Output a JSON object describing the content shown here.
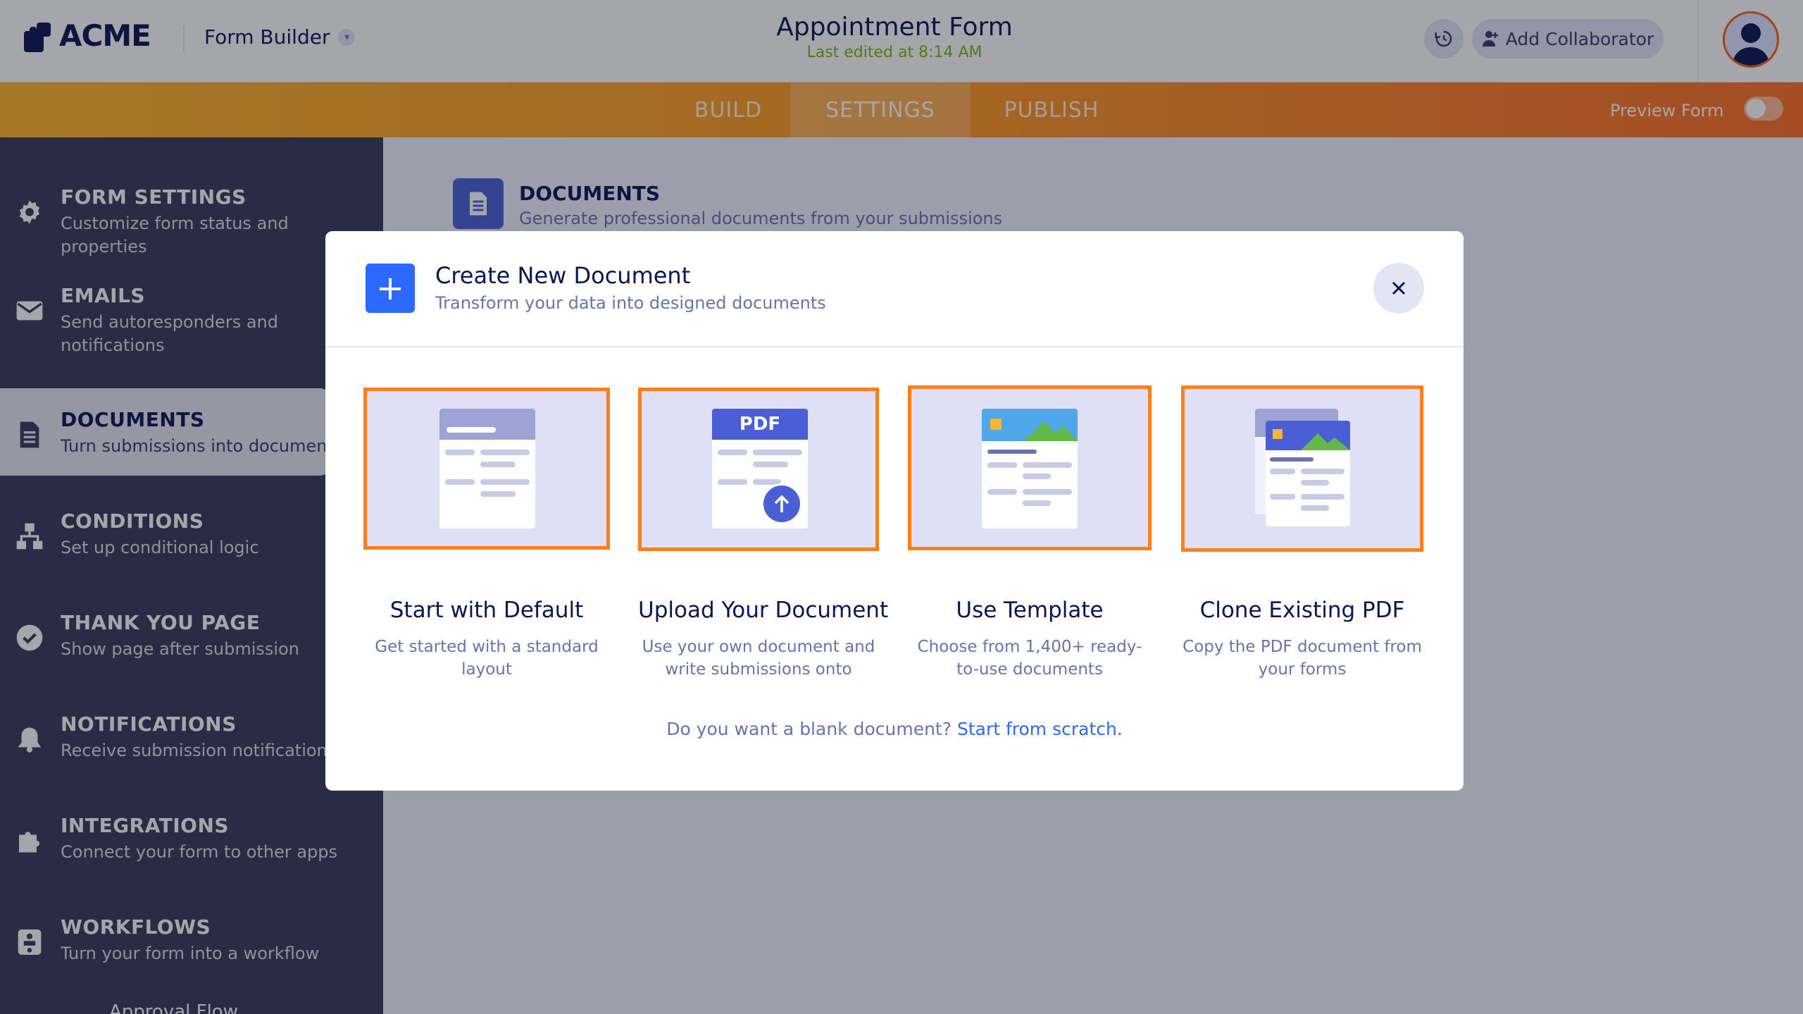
{
  "header": {
    "logo_text": "ACME",
    "builder_label": "Form Builder",
    "form_title": "Appointment Form",
    "last_edited": "Last edited at 8:14 AM",
    "collaborator_label": "Add Collaborator"
  },
  "tabs": [
    {
      "label": "BUILD"
    },
    {
      "label": "SETTINGS"
    },
    {
      "label": "PUBLISH"
    }
  ],
  "preview": {
    "label": "Preview Form",
    "enabled": false
  },
  "sidebar": {
    "items": [
      {
        "title": "FORM SETTINGS",
        "desc": "Customize form status and properties",
        "icon": "gear-icon"
      },
      {
        "title": "EMAILS",
        "desc": "Send autoresponders and notifications",
        "icon": "envelope-icon"
      },
      {
        "title": "DOCUMENTS",
        "desc": "Turn submissions into documents",
        "icon": "document-icon"
      },
      {
        "title": "CONDITIONS",
        "desc": "Set up conditional logic",
        "icon": "flowchart-icon"
      },
      {
        "title": "THANK YOU PAGE",
        "desc": "Show page after submission",
        "icon": "check-circle-icon"
      },
      {
        "title": "NOTIFICATIONS",
        "desc": "Receive submission notifications",
        "icon": "bell-icon"
      },
      {
        "title": "INTEGRATIONS",
        "desc": "Connect your form to other apps",
        "icon": "puzzle-icon"
      },
      {
        "title": "WORKFLOWS",
        "desc": "Turn your form into a workflow",
        "icon": "workflow-icon"
      }
    ],
    "bottom_label": "Approval Flow"
  },
  "main": {
    "section_title": "DOCUMENTS",
    "section_sub": "Generate professional documents from your submissions"
  },
  "modal": {
    "title": "Create New Document",
    "subtitle": "Transform your data into designed documents",
    "options": [
      {
        "title": "Start with Default",
        "desc": "Get started with a standard layout"
      },
      {
        "title": "Upload Your Document",
        "desc": "Use your own document and write submissions onto",
        "badge": "PDF"
      },
      {
        "title": "Use Template",
        "desc": "Choose from 1,400+ ready-to-use documents"
      },
      {
        "title": "Clone Existing PDF",
        "desc": "Copy the PDF document from your forms"
      }
    ],
    "footer_text": "Do you want a blank document?",
    "footer_link": "Start from scratch."
  },
  "colors": {
    "accent_blue": "#2e69ff",
    "highlight_orange": "#ff7f1f",
    "sidebar_bg": "#383a58",
    "navy": "#0a1551",
    "edited_green": "#78bb07"
  }
}
